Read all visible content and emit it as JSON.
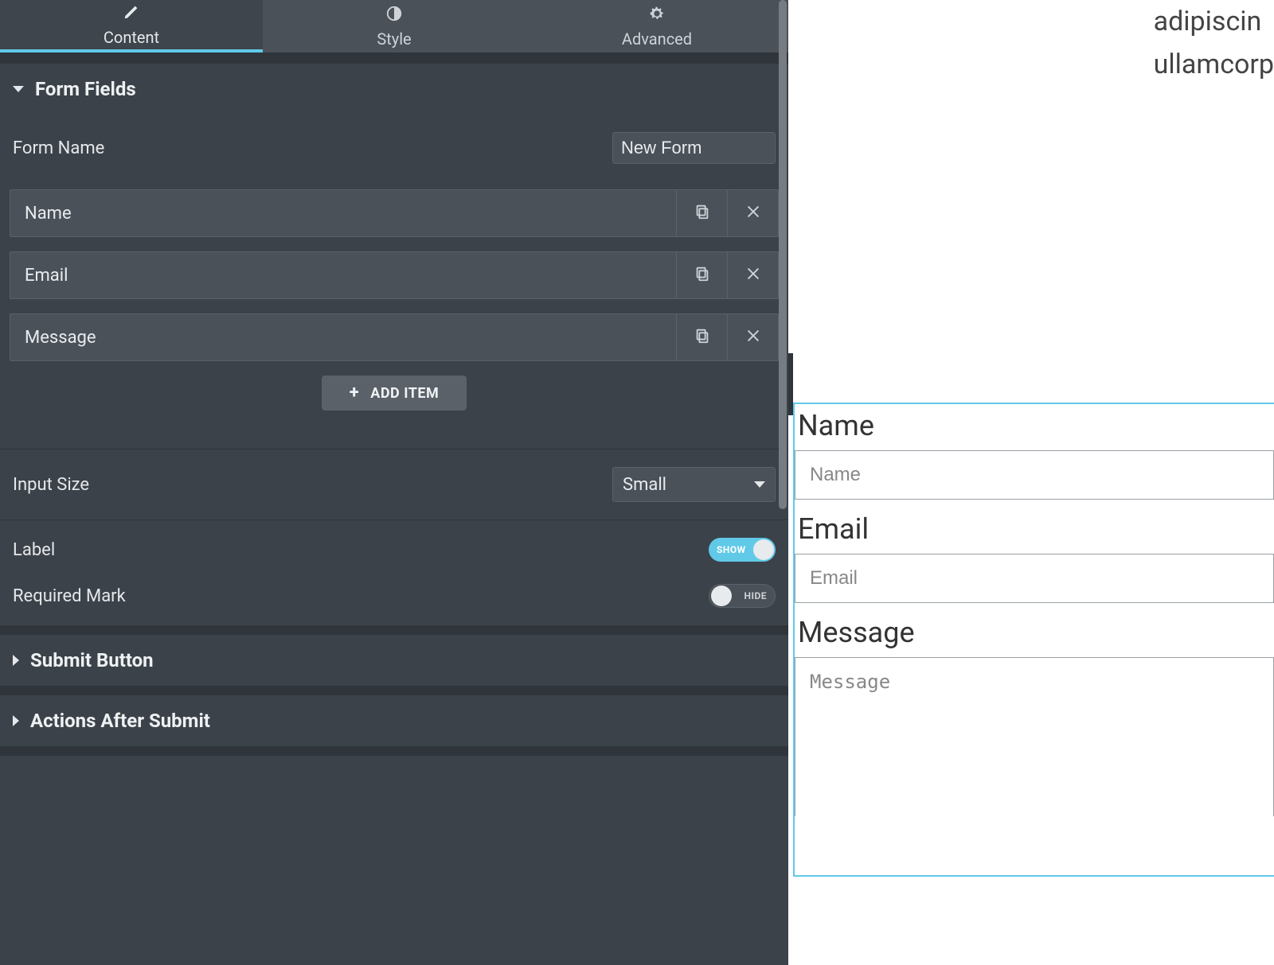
{
  "tabs": {
    "content": "Content",
    "style": "Style",
    "advanced": "Advanced"
  },
  "sections": {
    "form_fields": "Form Fields",
    "submit_button": "Submit Button",
    "actions_after_submit": "Actions After Submit"
  },
  "form": {
    "name_label": "Form Name",
    "name_value": "New Form",
    "input_size_label": "Input Size",
    "input_size_value": "Small",
    "label_toggle_label": "Label",
    "label_toggle_state": "SHOW",
    "required_mark_label": "Required Mark",
    "required_mark_state": "HIDE",
    "add_item": "ADD ITEM",
    "fields": [
      {
        "label": "Name"
      },
      {
        "label": "Email"
      },
      {
        "label": "Message"
      }
    ]
  },
  "preview": {
    "lorem1": "adipiscin",
    "lorem2": "ullamcorp",
    "fields": {
      "name_label": "Name",
      "name_placeholder": "Name",
      "email_label": "Email",
      "email_placeholder": "Email",
      "message_label": "Message",
      "message_placeholder": "Message"
    }
  }
}
